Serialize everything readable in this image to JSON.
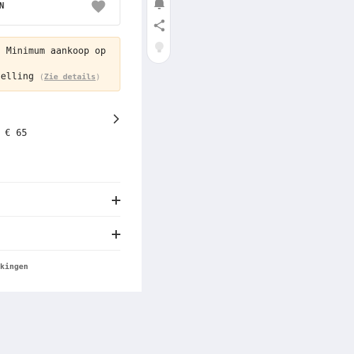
{
  "product_card": {
    "top_label": "AN",
    "favorite_icon": "heart-icon"
  },
  "promo": {
    "line1": "· Minimum aankoop op",
    "line2": "telling",
    "details_open": "(",
    "details_link": "Zie details",
    "details_close": ")"
  },
  "price": {
    "text": "€ 65",
    "chevron_icon": "chevron-right-icon"
  },
  "accordion": {
    "row1_icon": "plus-icon",
    "row2_icon": "plus-icon"
  },
  "footer": {
    "text": "kingen"
  },
  "toolbar": {
    "icons": [
      "bell-icon",
      "share-icon",
      "lightbulb-icon"
    ]
  },
  "colors": {
    "page_bg": "#eff0f5",
    "promo_bg": "#fff5e5",
    "promo_border": "#f6dcb3",
    "icon_gray": "#9e9e9e"
  }
}
